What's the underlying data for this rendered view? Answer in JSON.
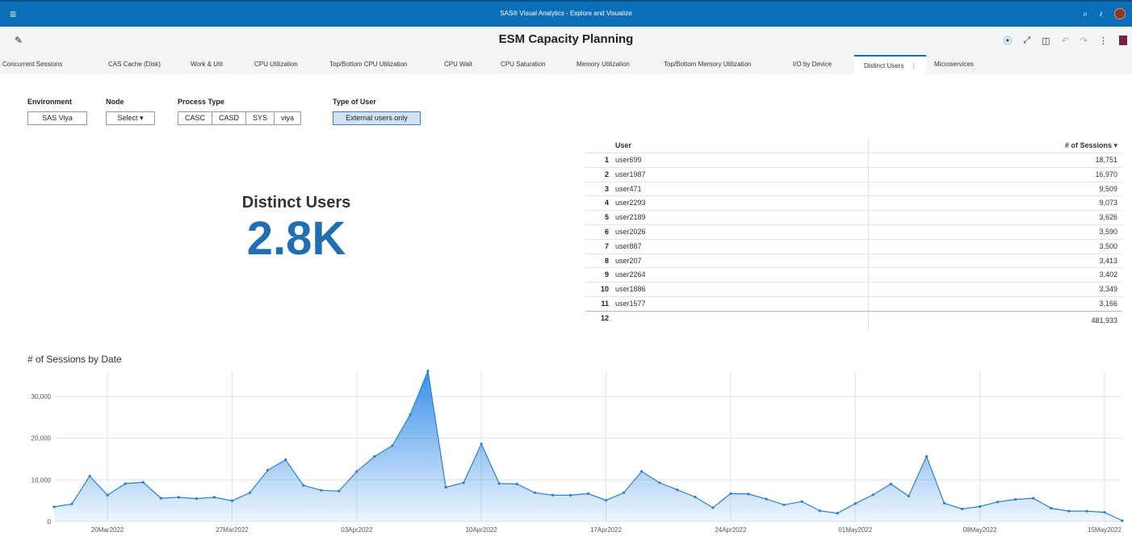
{
  "app": {
    "title": "SAS® Visual Analytics - Explore and Visualize",
    "menu_icon": "hamburger-icon"
  },
  "report": {
    "title": "ESM Capacity Planning"
  },
  "tabs": [
    {
      "label": "Concurrent Sessions"
    },
    {
      "label": "CAS Cache (Disk)"
    },
    {
      "label": "Work & Util"
    },
    {
      "label": "CPU Utilization"
    },
    {
      "label": "Top/Bottom CPU Utilization"
    },
    {
      "label": "CPU Wait"
    },
    {
      "label": "CPU Saturation"
    },
    {
      "label": "Memory Utilization"
    },
    {
      "label": "Top/Bottom Memory Utilization"
    },
    {
      "label": "I/O by Device"
    },
    {
      "label": "Distinct Users",
      "active": true
    },
    {
      "label": "Microservices"
    }
  ],
  "filters": {
    "environment": {
      "label": "Environment",
      "value": "SAS Viya"
    },
    "node": {
      "label": "Node",
      "value": "Select ▾"
    },
    "process_type": {
      "label": "Process Type",
      "options": [
        "CASC",
        "CASD",
        "SYS",
        "viya"
      ]
    },
    "user_type": {
      "label": "Type of User",
      "value": "External users only"
    }
  },
  "kpi": {
    "title": "Distinct Users",
    "value": "2.8K"
  },
  "table": {
    "headers": {
      "user": "User",
      "sessions": "# of Sessions ▾"
    },
    "rows": [
      {
        "idx": "1",
        "user": "user699",
        "sessions": "18,751"
      },
      {
        "idx": "2",
        "user": "user1987",
        "sessions": "16,970"
      },
      {
        "idx": "3",
        "user": "user471",
        "sessions": "9,509"
      },
      {
        "idx": "4",
        "user": "user2293",
        "sessions": "9,073"
      },
      {
        "idx": "5",
        "user": "user2189",
        "sessions": "3,626"
      },
      {
        "idx": "6",
        "user": "user2026",
        "sessions": "3,590"
      },
      {
        "idx": "7",
        "user": "user887",
        "sessions": "3,500"
      },
      {
        "idx": "8",
        "user": "user207",
        "sessions": "3,413"
      },
      {
        "idx": "9",
        "user": "user2264",
        "sessions": "3,402"
      },
      {
        "idx": "10",
        "user": "user1886",
        "sessions": "3,349"
      },
      {
        "idx": "11",
        "user": "user1577",
        "sessions": "3,166"
      }
    ],
    "total": {
      "idx": "12",
      "user": "",
      "sessions": "481,933"
    }
  },
  "chart_data": {
    "type": "area",
    "title": "# of Sessions by Date",
    "xlabel": "",
    "ylabel": "",
    "ylim": [
      0,
      36000
    ],
    "yticks": [
      0,
      10000,
      20000,
      30000
    ],
    "ytick_labels": [
      "0",
      "10,000",
      "20,000",
      "30,000"
    ],
    "xticks": [
      "20Mar2022",
      "27Mar2022",
      "03Apr2022",
      "10Apr2022",
      "17Apr2022",
      "24Apr2022",
      "01May2022",
      "08May2022",
      "15May2022"
    ],
    "grid": true,
    "color": "#2f8ae8",
    "series": [
      {
        "x": [
          "2022-03-17",
          "2022-03-18",
          "2022-03-19",
          "2022-03-20",
          "2022-03-21",
          "2022-03-22",
          "2022-03-23",
          "2022-03-24",
          "2022-03-25",
          "2022-03-26",
          "2022-03-27",
          "2022-03-28",
          "2022-03-29",
          "2022-03-30",
          "2022-03-31",
          "2022-04-01",
          "2022-04-02",
          "2022-04-03",
          "2022-04-04",
          "2022-04-05",
          "2022-04-06",
          "2022-04-07",
          "2022-04-08",
          "2022-04-09",
          "2022-04-10",
          "2022-04-11",
          "2022-04-12",
          "2022-04-13",
          "2022-04-14",
          "2022-04-15",
          "2022-04-16",
          "2022-04-17",
          "2022-04-18",
          "2022-04-19",
          "2022-04-20",
          "2022-04-21",
          "2022-04-22",
          "2022-04-23",
          "2022-04-24",
          "2022-04-25",
          "2022-04-26",
          "2022-04-27",
          "2022-04-28",
          "2022-04-29",
          "2022-04-30",
          "2022-05-01",
          "2022-05-02",
          "2022-05-03",
          "2022-05-04",
          "2022-05-05",
          "2022-05-06",
          "2022-05-07",
          "2022-05-08",
          "2022-05-09",
          "2022-05-10",
          "2022-05-11",
          "2022-05-12",
          "2022-05-13",
          "2022-05-14",
          "2022-05-15",
          "2022-05-16"
        ],
        "values": [
          3500,
          4200,
          10900,
          6300,
          9100,
          9400,
          5600,
          5800,
          5500,
          5800,
          5000,
          6900,
          12300,
          14800,
          8700,
          7500,
          7300,
          12000,
          15600,
          18200,
          25600,
          36100,
          8200,
          9300,
          18600,
          9100,
          9000,
          6900,
          6300,
          6300,
          6700,
          5100,
          6900,
          12000,
          9300,
          7600,
          5900,
          3300,
          6700,
          6600,
          5400,
          4000,
          4800,
          2600,
          2000,
          4300,
          6400,
          9000,
          6100,
          15600,
          4400,
          3000,
          3600,
          4700,
          5300,
          5600,
          3200,
          2500,
          2500,
          2200,
          200
        ]
      }
    ]
  }
}
